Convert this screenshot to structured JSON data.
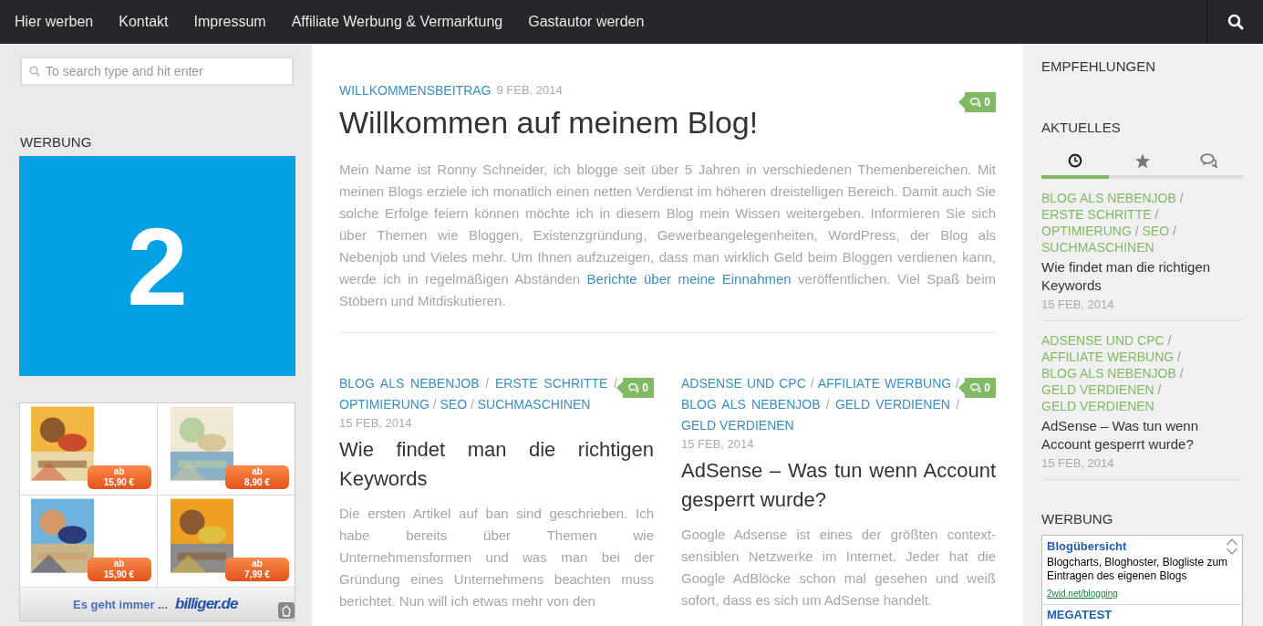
{
  "nav": {
    "items": [
      "Hier werben",
      "Kontakt",
      "Impressum",
      "Affiliate Werbung & Vermarktung",
      "Gastautor werden"
    ]
  },
  "left_sidebar": {
    "search": {
      "placeholder": "To search type and hit enter"
    },
    "ad_heading": "WERBUNG",
    "banner": {
      "text": "2"
    },
    "product_ad": {
      "products": [
        {
          "kind": "picture",
          "prefix": "ab",
          "price": "15,90 €"
        },
        {
          "kind": "picture",
          "prefix": "ab",
          "price": "8,90 €"
        },
        {
          "kind": "picture",
          "prefix": "ab",
          "price": "15,90 €"
        },
        {
          "kind": "picture",
          "prefix": "ab",
          "price": "7,99 €"
        }
      ],
      "slogan": "Es geht immer ...",
      "logo": "billiger.de"
    }
  },
  "featured": {
    "category": "WILLKOMMENSBEITRAG",
    "date": "9 FEB, 2014",
    "comments": "0",
    "title": "Willkommen auf meinem Blog!",
    "text_before": "Mein Name ist Ronny Schneider, ich blogge seit über 5 Jahren in verschiedenen Themenbereichen. Mit meinen Blogs erziele ich monatlich einen netten Verdienst im höheren dreistelligen Bereich. Damit auch Sie solche Erfolge feiern können möchte ich in diesem Blog mein Wissen weitergeben. Informieren Sie sich über Themen wie Bloggen, Existenzgründung, Gewerbeangelegenheiten, WordPress, der Blog als Nebenjob und Vieles mehr. Um Ihnen aufzuzeigen, dass man wirklich Geld beim Bloggen verdienen kann, werde ich in regelmäßigen Abständen",
    "link": "Berichte über meine Einnahmen",
    "text_after": "veröffentlichen. Viel Spaß beim Stöbern und Mitdiskutieren."
  },
  "posts": [
    {
      "categories": [
        "BLOG ALS NEBENJOB",
        "ERSTE SCHRITTE",
        "OPTIMIERUNG",
        "SEO",
        "SUCHMASCHINEN"
      ],
      "separator": "/",
      "comments": "0",
      "date": "15 FEB, 2014",
      "title": "Wie findet man die richtigen Keywords",
      "excerpt": "Die ersten Artikel auf ban sind geschrieben. Ich habe bereits über Themen wie Unternehmensformen und was man bei der Gründung eines Unternehmens beachten muss berichtet. Nun will ich etwas mehr von den"
    },
    {
      "categories": [
        "ADSENSE UND CPC",
        "AFFILIATE WERBUNG",
        "BLOG ALS NEBENJOB",
        "GELD VERDIENEN",
        "GELD VERDIENEN"
      ],
      "separator": "/",
      "comments": "0",
      "date": "15 FEB, 2014",
      "title": "AdSense – Was tun wenn Account gesperrt wurde?",
      "excerpt": "Google Adsense ist eines der größten context-sensiblen Netzwerke im Internet. Jeder hat die Google AdBlöcke schon mal gesehen und weiß sofort, dass es sich um AdSense handelt."
    }
  ],
  "right_sidebar": {
    "recommendations_heading": "EMPFEHLUNGEN",
    "current_heading": "AKTUELLES",
    "tabs": [
      {
        "kind": "recent",
        "selected": true
      },
      {
        "kind": "popular",
        "selected": false
      },
      {
        "kind": "comments",
        "selected": false
      }
    ],
    "items": [
      {
        "categories": [
          "BLOG ALS NEBENJOB",
          "ERSTE SCHRITTE",
          "OPTIMIERUNG",
          "SEO",
          "SUCHMASCHINEN"
        ],
        "separator": "/",
        "title": "Wie findet man die richtigen Keywords",
        "date": "15 FEB, 2014"
      },
      {
        "categories": [
          "ADSENSE UND CPC",
          "AFFILIATE WERBUNG",
          "BLOG ALS NEBENJOB",
          "GELD VERDIENEN",
          "GELD VERDIENEN"
        ],
        "separator": "/",
        "title": "AdSense – Was tun wenn Account gesperrt wurde?",
        "date": "15 FEB, 2014"
      }
    ],
    "ad_heading": "WERBUNG",
    "text_ad": {
      "title": "Blogübersicht",
      "text": "Blogcharts, Bloghoster, Blogliste zum Eintragen des eigenen Blogs",
      "url": "2wid.net/blogging",
      "next_title": "MEGATEST"
    }
  }
}
